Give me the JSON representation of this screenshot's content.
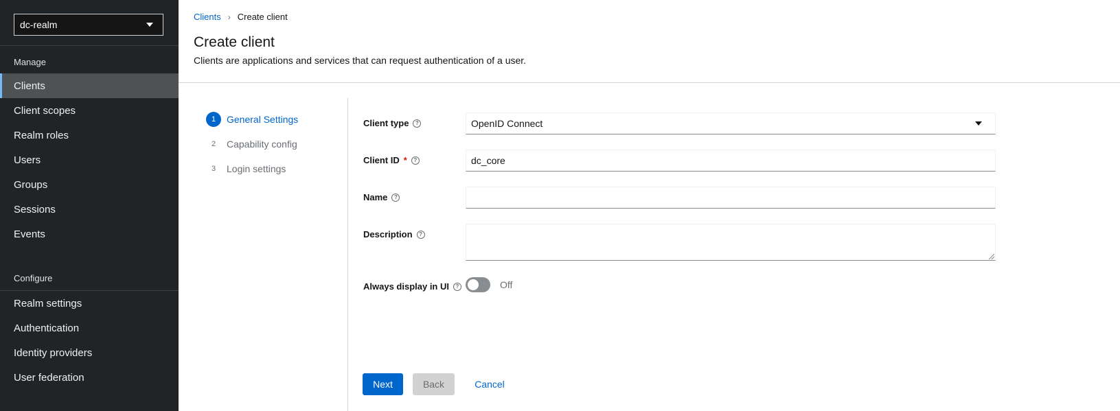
{
  "sidebar": {
    "realm": "dc-realm",
    "manage_title": "Manage",
    "manage_items": [
      {
        "label": "Clients"
      },
      {
        "label": "Client scopes"
      },
      {
        "label": "Realm roles"
      },
      {
        "label": "Users"
      },
      {
        "label": "Groups"
      },
      {
        "label": "Sessions"
      },
      {
        "label": "Events"
      }
    ],
    "configure_title": "Configure",
    "configure_items": [
      {
        "label": "Realm settings"
      },
      {
        "label": "Authentication"
      },
      {
        "label": "Identity providers"
      },
      {
        "label": "User federation"
      }
    ]
  },
  "breadcrumb": {
    "parent": "Clients",
    "current": "Create client"
  },
  "header": {
    "title": "Create client",
    "description": "Clients are applications and services that can request authentication of a user."
  },
  "wizard": {
    "steps": [
      {
        "num": "1",
        "label": "General Settings"
      },
      {
        "num": "2",
        "label": "Capability config"
      },
      {
        "num": "3",
        "label": "Login settings"
      }
    ]
  },
  "form": {
    "client_type": {
      "label": "Client type",
      "value": "OpenID Connect"
    },
    "client_id": {
      "label": "Client ID",
      "required": "*",
      "value": "dc_core"
    },
    "name": {
      "label": "Name",
      "value": ""
    },
    "description": {
      "label": "Description",
      "value": ""
    },
    "always_display": {
      "label": "Always display in UI",
      "state": "Off"
    }
  },
  "buttons": {
    "next": "Next",
    "back": "Back",
    "cancel": "Cancel"
  },
  "colors": {
    "accent": "#0066cc",
    "sidebar_bg": "#212427",
    "active_nav_bg": "#4f5255",
    "required": "#c9190b"
  }
}
